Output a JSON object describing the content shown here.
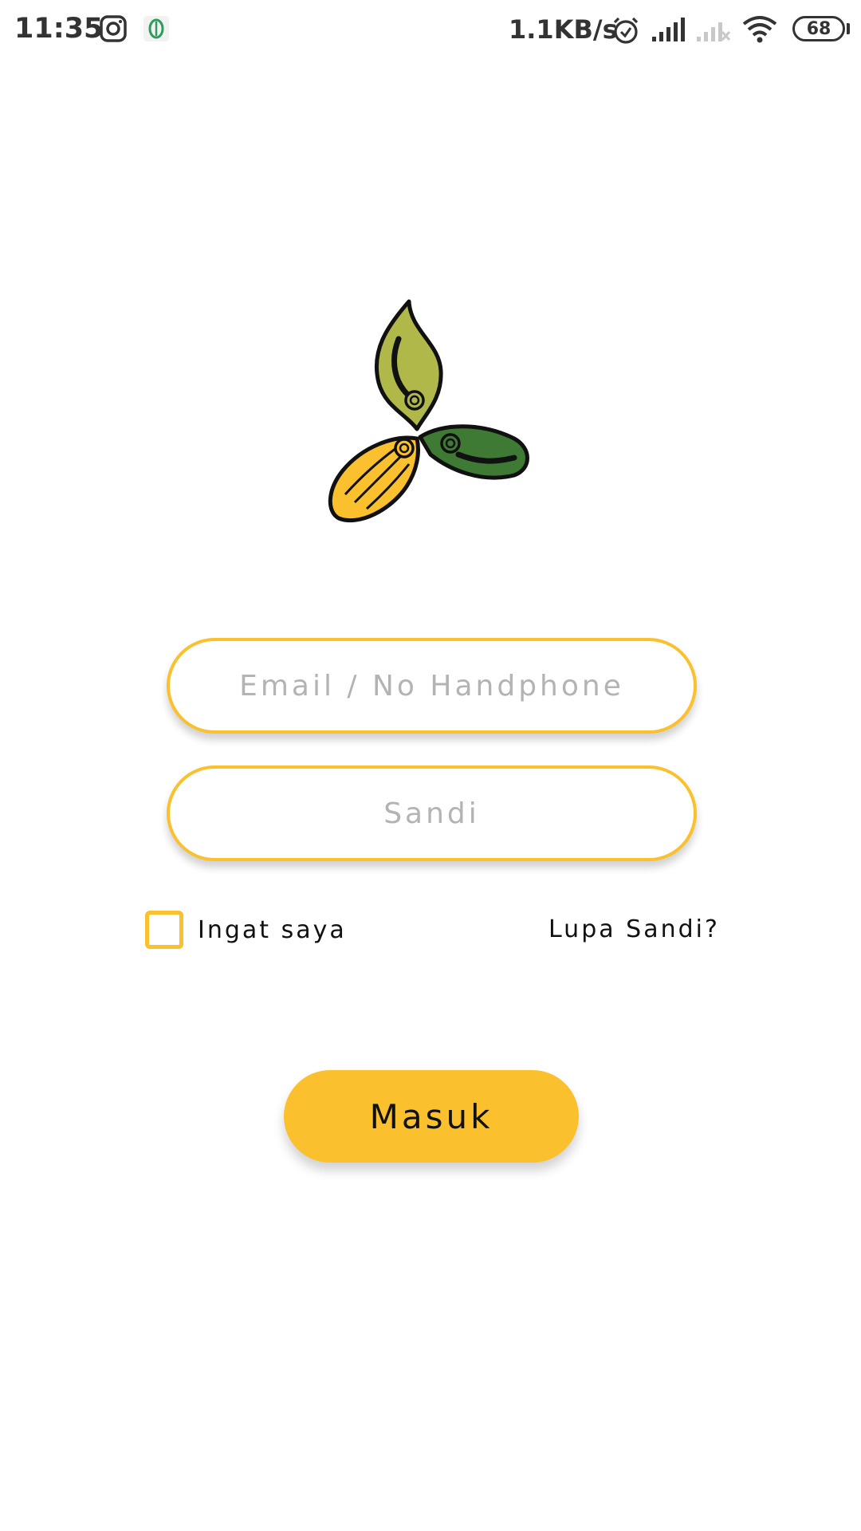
{
  "status_bar": {
    "time": "11:35",
    "left_icons": [
      "instagram-icon",
      "app-notification-icon"
    ],
    "network_speed": "1.1KB/s",
    "right_icons": [
      "alarm-icon",
      "signal-icon",
      "signal-no-service-icon",
      "wifi-icon"
    ],
    "battery_level": "68"
  },
  "logo": {
    "icon": "three-leaf-pod-logo-icon",
    "colors": {
      "olive": "#b0b84a",
      "dark_green": "#3f7a34",
      "yellow": "#fbc02d"
    }
  },
  "login_form": {
    "email_placeholder": "Email / No Handphone",
    "email_value": "",
    "password_placeholder": "Sandi",
    "password_value": "",
    "remember_label": "Ingat saya",
    "remember_checked": false,
    "forgot_label": "Lupa Sandi?",
    "submit_label": "Masuk"
  },
  "theme": {
    "accent": "#fbc02d",
    "background": "#ffffff",
    "placeholder": "#b3b3b3"
  }
}
